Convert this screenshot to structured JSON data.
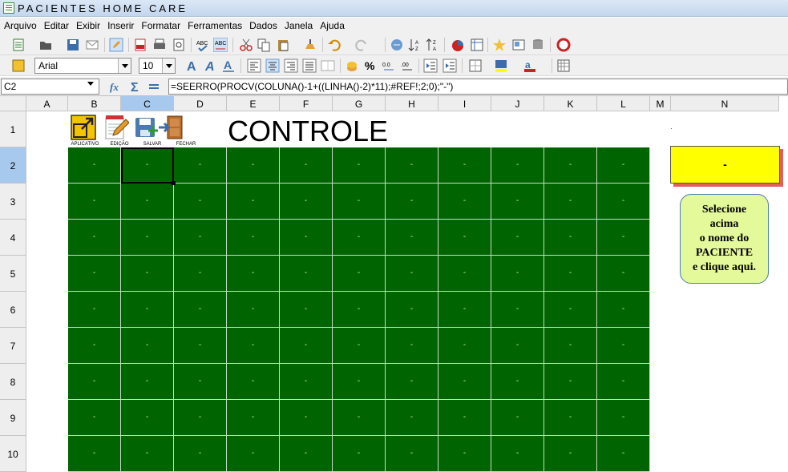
{
  "window": {
    "title": "PACIENTES  HOME  CARE"
  },
  "menu": [
    "Arquivo",
    "Editar",
    "Exibir",
    "Inserir",
    "Formatar",
    "Ferramentas",
    "Dados",
    "Janela",
    "Ajuda"
  ],
  "format_bar": {
    "font_name": "Arial",
    "font_size": "10"
  },
  "formula_bar": {
    "cell_ref": "C2",
    "formula": "=SEERRO(PROCV(COLUNA()-1+((LINHA()-2)*11);#REF!;2;0);\"-\")"
  },
  "columns": [
    "A",
    "B",
    "C",
    "D",
    "E",
    "F",
    "G",
    "H",
    "I",
    "J",
    "K",
    "L",
    "M",
    "N"
  ],
  "rows": [
    "1",
    "2",
    "3",
    "4",
    "5",
    "6",
    "7",
    "8",
    "9",
    "10"
  ],
  "active_cell": {
    "column": "C",
    "row": "2"
  },
  "sheet": {
    "heading": "CONTROLE",
    "shortcuts": [
      {
        "label": "APLICATIVO",
        "icon": "fullscreen-icon"
      },
      {
        "label": "EDIÇÃO",
        "icon": "edit-notepad-icon"
      },
      {
        "label": "SALVAR",
        "icon": "save-icon"
      },
      {
        "label": "FECHAR",
        "icon": "exit-door-icon"
      }
    ],
    "grid_placeholder": "-",
    "patient_value": "-",
    "instruction_lines": [
      "Selecione",
      "acima",
      "o nome do",
      "PACIENTE",
      "e clique aqui."
    ],
    "stray_mark": "·"
  },
  "colors": {
    "grid_fill": "#006400",
    "patient_box": "#ffff00",
    "instruction_button": "#e4f99a",
    "selection_header": "#a7c9ee"
  }
}
